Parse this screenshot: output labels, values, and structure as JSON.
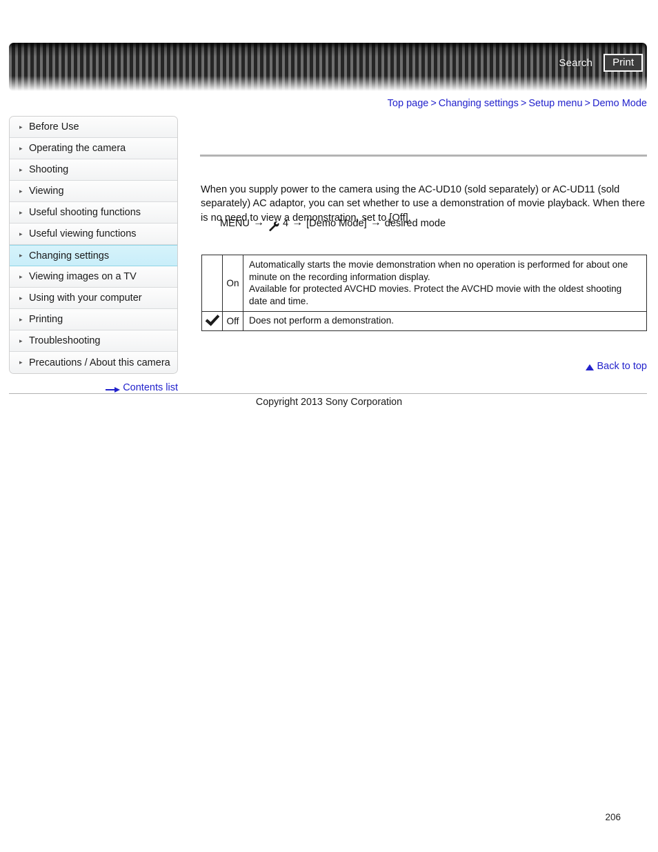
{
  "header": {
    "search_label": "Search",
    "print_label": "Print",
    "search_icon": "search-icon",
    "print_icon": "print-icon"
  },
  "breadcrumb": {
    "separator": ">",
    "items": [
      {
        "label": "Top page"
      },
      {
        "label": "Changing settings"
      },
      {
        "label": "Setup menu"
      },
      {
        "label": "Demo Mode"
      }
    ]
  },
  "sidebar": {
    "bullet": "▸",
    "items": [
      {
        "label": "Before Use",
        "active": false
      },
      {
        "label": "Operating the camera",
        "active": false
      },
      {
        "label": "Shooting",
        "active": false
      },
      {
        "label": "Viewing",
        "active": false
      },
      {
        "label": "Useful shooting functions",
        "active": false
      },
      {
        "label": "Useful viewing functions",
        "active": false
      },
      {
        "label": "Changing settings",
        "active": true
      },
      {
        "label": "Viewing images on a TV",
        "active": false
      },
      {
        "label": "Using with your computer",
        "active": false
      },
      {
        "label": "Printing",
        "active": false
      },
      {
        "label": "Troubleshooting",
        "active": false
      },
      {
        "label": "Precautions / About this camera",
        "active": false
      }
    ],
    "contents_list_label": "Contents list",
    "contents_list_icon": "right-arrow-icon"
  },
  "main": {
    "paragraph": "When you supply power to the camera using the AC-UD10 (sold separately) or AC-UD11 (sold separately) AC adaptor, you can set whether to use a demonstration of movie playback. When there is no need to view a demonstration, set to [Off].",
    "menu_path": {
      "start": "MENU",
      "arrow": "→",
      "setup_icon": "wrench-setup-icon",
      "setup_number": "4",
      "item": "[Demo Mode]",
      "end": "desired mode"
    },
    "table": {
      "rows": [
        {
          "checked": false,
          "check_icon": "",
          "mode": "On",
          "description": "Automatically starts the movie demonstration when no operation is performed for about one minute on the recording information display.\nAvailable for protected AVCHD movies. Protect the AVCHD movie with the oldest shooting date and time."
        },
        {
          "checked": true,
          "check_icon": "checkmark-icon",
          "mode": "Off",
          "description": "Does not perform a demonstration."
        }
      ]
    }
  },
  "footer": {
    "back_to_top_label": "Back to top",
    "back_to_top_icon": "up-triangle-icon",
    "copyright": "Copyright 2013 Sony Corporation",
    "page_number": "206"
  },
  "colors": {
    "link": "#2222cc",
    "active_nav": "#c9eef9",
    "rule": "#b3b3b3"
  }
}
